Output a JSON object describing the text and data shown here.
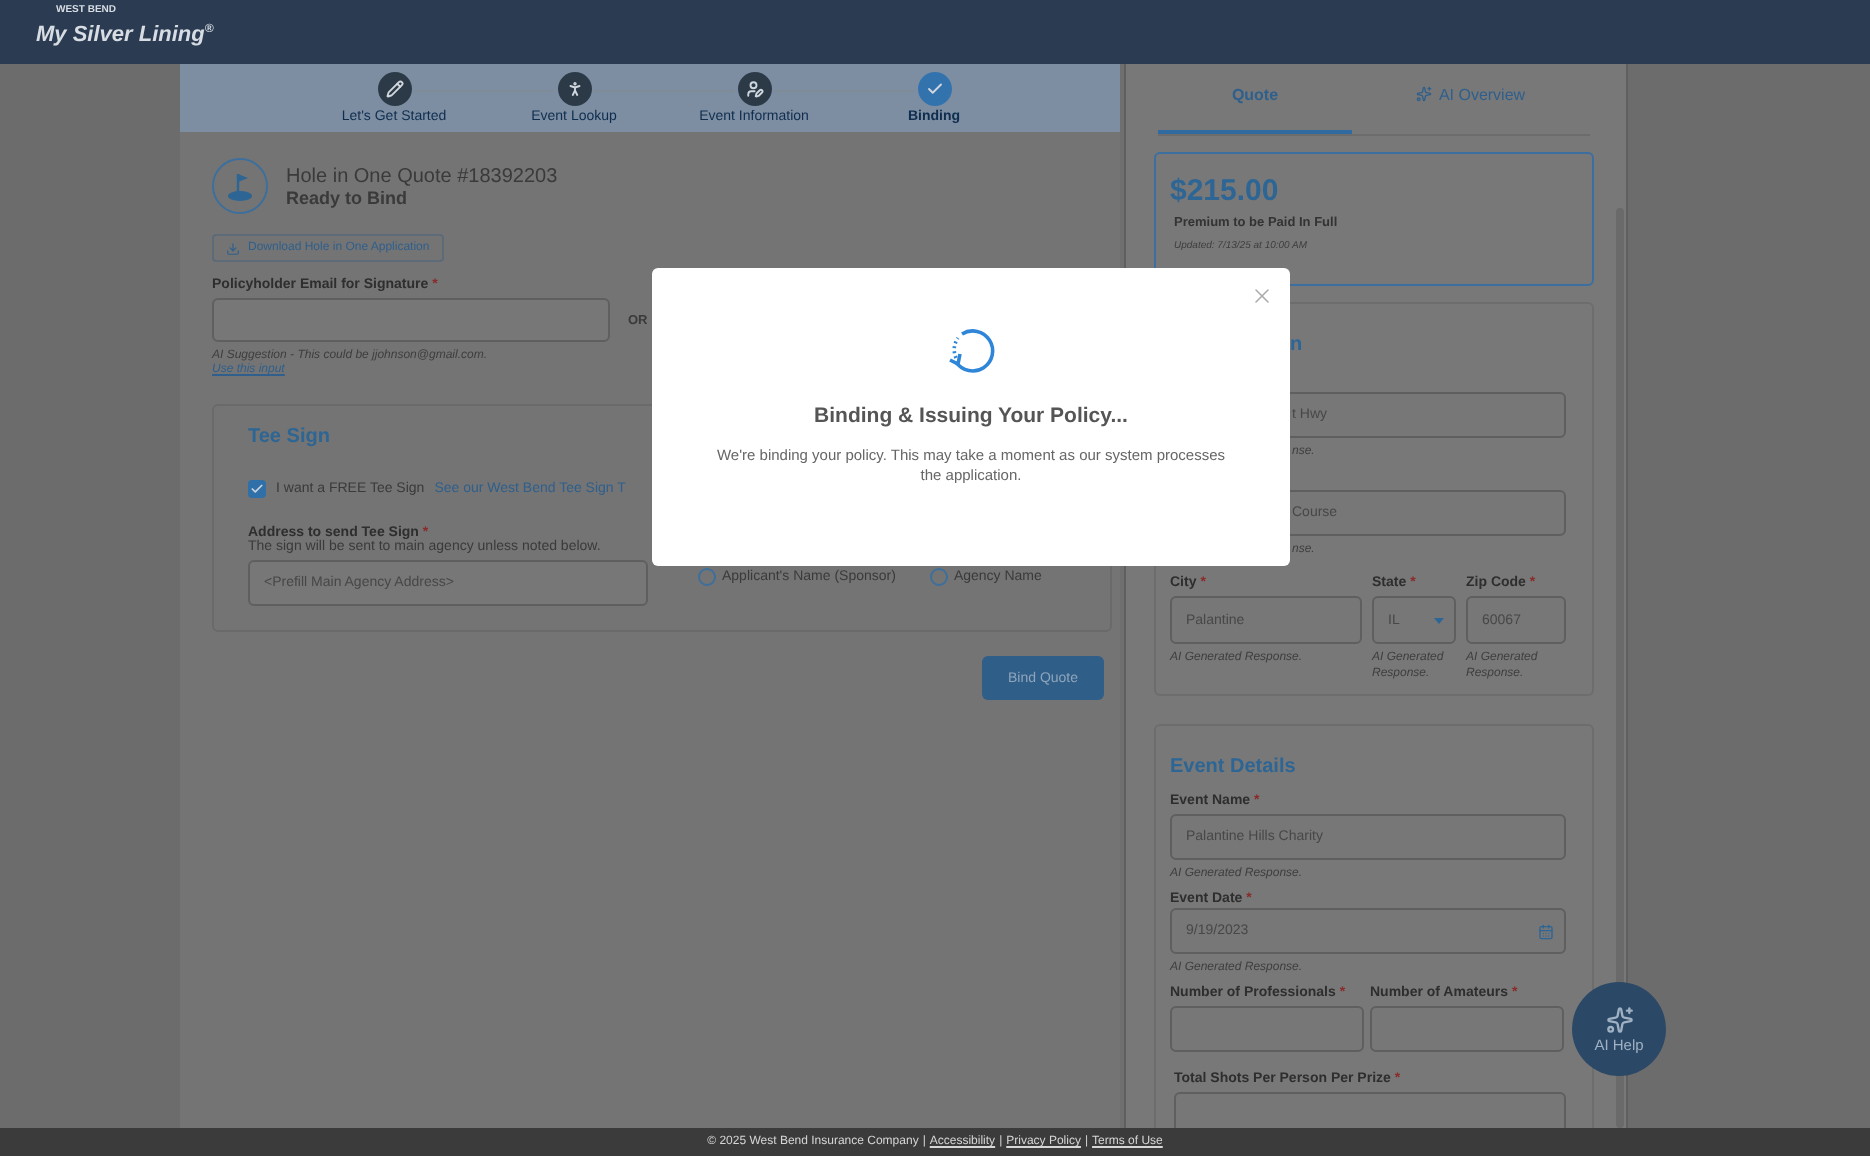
{
  "header": {
    "brand_small": "WEST BEND",
    "logo": "My Silver Lining",
    "logo_mark": "®"
  },
  "steps": [
    {
      "label": "Let's Get Started",
      "kind": "pencil",
      "current": false
    },
    {
      "label": "Event Lookup",
      "kind": "golfer",
      "current": false
    },
    {
      "label": "Event Information",
      "kind": "person",
      "current": false
    },
    {
      "label": "Binding",
      "kind": "check",
      "current": true
    }
  ],
  "quote": {
    "title": "Hole in One Quote #18392203",
    "status": "Ready to Bind",
    "download": "Download Hole in One Application",
    "email_label": "Policyholder Email for Signature",
    "email_mark": "*",
    "or": "OR",
    "ai_suggestion": "AI Suggestion - This could be jjohnson@gmail.com.",
    "use_input": "Use this input"
  },
  "tee_sign": {
    "title": "Tee Sign",
    "checkbox": {
      "label": "I want a FREE Tee Sign",
      "checked": true
    },
    "link": "See our West Bend Tee Sign T",
    "address_label": "Address to send Tee Sign",
    "address_mark": "*",
    "hint": "The sign will be sent to main agency unless noted below.",
    "address_placeholder": "<Prefill Main Agency Address>",
    "radios": [
      {
        "label": "Applicant's Name (Sponsor)",
        "selected": false
      },
      {
        "label": "Agency Name",
        "selected": false
      }
    ]
  },
  "bind_button": "Bind Quote",
  "sidebar": {
    "tabs": [
      {
        "label": "Quote",
        "selected": true,
        "kind": "text"
      },
      {
        "label": "AI Overview",
        "selected": false,
        "kind": "sparkle"
      }
    ],
    "price": "$215.00",
    "price_label": "Premium to be Paid In Full",
    "updated": "Updated: 7/13/25 at 10:00 AM",
    "location": {
      "title": "n",
      "fields": [
        {
          "value": "t Hwy",
          "helper": "nse."
        },
        {
          "value": "Course",
          "helper": "nse."
        }
      ],
      "row": [
        {
          "label": "City",
          "mark": "*",
          "value": "Palantine",
          "kind": "text",
          "helper": "AI Generated Response."
        },
        {
          "label": "State",
          "mark": "*",
          "value": "IL",
          "kind": "select",
          "helper": "AI Generated Response."
        },
        {
          "label": "Zip Code",
          "mark": "*",
          "value": "60067",
          "kind": "text",
          "helper": "AI Generated Response."
        }
      ]
    },
    "event": {
      "title": "Event Details",
      "name_label": "Event Name",
      "name_mark": "*",
      "name_value": "Palantine Hills Charity",
      "name_helper": "AI Generated Response.",
      "date_label": "Event Date",
      "date_mark": "*",
      "date_value": "9/19/2023",
      "date_helper": "AI Generated Response.",
      "counts": [
        {
          "label": "Number of Professionals",
          "mark": "*"
        },
        {
          "label": "Number of Amateurs",
          "mark": "*"
        }
      ],
      "shots_label": "Total Shots Per Person Per Prize",
      "shots_mark": "*"
    }
  },
  "ai_help": {
    "label": "AI Help"
  },
  "modal": {
    "title": "Binding & Issuing Your Policy...",
    "message": "We're binding your policy. This may take a moment as our system processes the application."
  },
  "footer": [
    {
      "kind": "text",
      "text": "© 2025 West Bend Insurance Company"
    },
    {
      "kind": "separator",
      "text": "|"
    },
    {
      "kind": "link",
      "text": "Accessibility"
    },
    {
      "kind": "separator",
      "text": "|"
    },
    {
      "kind": "link",
      "text": "Privacy Policy"
    },
    {
      "kind": "separator",
      "text": "|"
    },
    {
      "kind": "link",
      "text": "Terms of Use"
    }
  ]
}
